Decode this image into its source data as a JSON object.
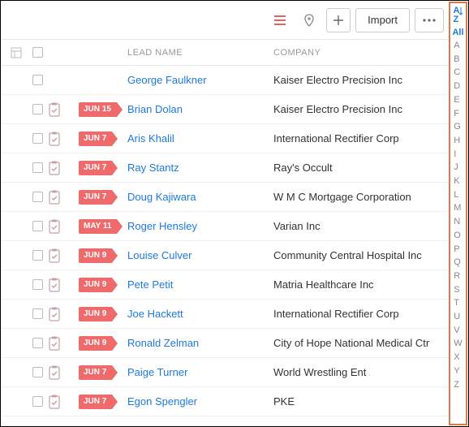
{
  "toolbar": {
    "import_label": "Import"
  },
  "columns": {
    "lead_name": "LEAD NAME",
    "company": "COMPANY"
  },
  "alpha": {
    "sort_label": "A↓Z",
    "all_label": "All",
    "letters": [
      "A",
      "B",
      "C",
      "D",
      "E",
      "F",
      "G",
      "H",
      "I",
      "J",
      "K",
      "L",
      "M",
      "N",
      "O",
      "P",
      "Q",
      "R",
      "S",
      "T",
      "U",
      "V",
      "W",
      "X",
      "Y",
      "Z"
    ]
  },
  "rows": [
    {
      "has_task": false,
      "date": "",
      "name": "George Faulkner",
      "company": "Kaiser Electro Precision Inc"
    },
    {
      "has_task": true,
      "date": "JUN 15",
      "name": "Brian Dolan",
      "company": "Kaiser Electro Precision Inc"
    },
    {
      "has_task": true,
      "date": "JUN 7",
      "name": "Aris Khalil",
      "company": "International Rectifier Corp"
    },
    {
      "has_task": true,
      "date": "JUN 7",
      "name": "Ray Stantz",
      "company": "Ray's Occult"
    },
    {
      "has_task": true,
      "date": "JUN 7",
      "name": "Doug Kajiwara",
      "company": "W M C Mortgage Corporation"
    },
    {
      "has_task": true,
      "date": "MAY 11",
      "name": "Roger Hensley",
      "company": "Varian Inc"
    },
    {
      "has_task": true,
      "date": "JUN 9",
      "name": "Louise Culver",
      "company": "Community Central Hospital Inc"
    },
    {
      "has_task": true,
      "date": "JUN 9",
      "name": "Pete Petit",
      "company": "Matria Healthcare Inc"
    },
    {
      "has_task": true,
      "date": "JUN 9",
      "name": "Joe Hackett",
      "company": "International Rectifier Corp"
    },
    {
      "has_task": true,
      "date": "JUN 9",
      "name": "Ronald Zelman",
      "company": "City of Hope National Medical Ctr"
    },
    {
      "has_task": true,
      "date": "JUN 7",
      "name": "Paige Turner",
      "company": "World Wrestling Ent"
    },
    {
      "has_task": true,
      "date": "JUN 7",
      "name": "Egon Spengler",
      "company": "PKE"
    }
  ]
}
